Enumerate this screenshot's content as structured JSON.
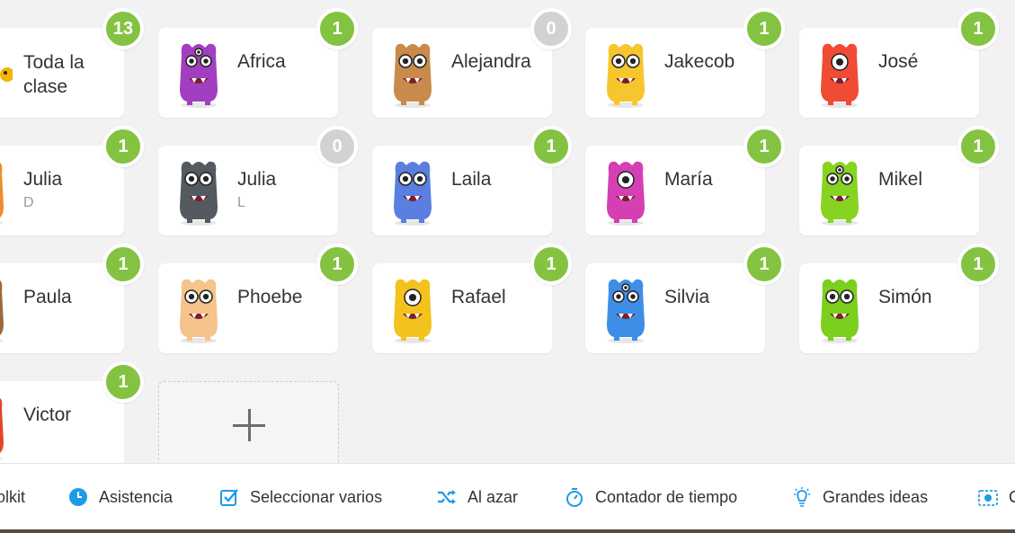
{
  "students": [
    {
      "name": "Toda la clase",
      "sub": "",
      "points": "13",
      "avatar": "whole-class-icon",
      "color": "#f4b400"
    },
    {
      "name": "Africa",
      "sub": "",
      "points": "1",
      "avatar": "purple-monster-avatar",
      "color": "#a23fc0"
    },
    {
      "name": "Alejandra",
      "sub": "",
      "points": "0",
      "avatar": "hamster-monster-avatar",
      "color": "#c98a4b"
    },
    {
      "name": "Jakecob",
      "sub": "",
      "points": "1",
      "avatar": "yellow-monster-avatar",
      "color": "#f6c62c"
    },
    {
      "name": "José",
      "sub": "",
      "points": "1",
      "avatar": "red-monster-avatar",
      "color": "#ef4b35"
    },
    {
      "name": "Julia",
      "sub": "D",
      "points": "1",
      "avatar": "orange-monster-avatar",
      "color": "#f08a2c"
    },
    {
      "name": "Julia",
      "sub": "L",
      "points": "0",
      "avatar": "gray-monster-avatar",
      "color": "#555a60"
    },
    {
      "name": "Laila",
      "sub": "",
      "points": "1",
      "avatar": "blue-monster-avatar",
      "color": "#5a7fe0"
    },
    {
      "name": "María",
      "sub": "",
      "points": "1",
      "avatar": "pink-monster-avatar",
      "color": "#d63fb3"
    },
    {
      "name": "Mikel",
      "sub": "",
      "points": "1",
      "avatar": "green-monster-avatar",
      "color": "#86d322"
    },
    {
      "name": "Paula",
      "sub": "",
      "points": "1",
      "avatar": "brown-monster-avatar",
      "color": "#9b6a3c"
    },
    {
      "name": "Phoebe",
      "sub": "",
      "points": "1",
      "avatar": "beige-monster-avatar",
      "color": "#f4c48a"
    },
    {
      "name": "Rafael",
      "sub": "",
      "points": "1",
      "avatar": "one-eyed-monster-avatar",
      "color": "#f4c21d"
    },
    {
      "name": "Silvia",
      "sub": "",
      "points": "1",
      "avatar": "blue-bird-monster-avatar",
      "color": "#3e8ee8"
    },
    {
      "name": "Simón",
      "sub": "",
      "points": "1",
      "avatar": "lime-monster-avatar",
      "color": "#7ccf1c"
    },
    {
      "name": "Victor",
      "sub": "",
      "points": "1",
      "avatar": "red-orange-monster-avatar",
      "color": "#e2452a"
    }
  ],
  "add_student": {
    "icon": "plus-icon"
  },
  "toolbar": [
    {
      "label": "olkit",
      "icon": "toolkit-icon"
    },
    {
      "label": "Asistencia",
      "icon": "clock-icon"
    },
    {
      "label": "Seleccionar varios",
      "icon": "checkbox-icon"
    },
    {
      "label": "Al azar",
      "icon": "shuffle-icon"
    },
    {
      "label": "Contador de tiempo",
      "icon": "stopwatch-icon"
    },
    {
      "label": "Grandes ideas",
      "icon": "lightbulb-icon"
    },
    {
      "label": "C",
      "icon": "camera-icon"
    }
  ],
  "colors": {
    "badge_active": "#84c341",
    "badge_zero": "#d2d2d2",
    "toolbar_icon": "#1d9be6",
    "background": "#f2f2f2"
  }
}
